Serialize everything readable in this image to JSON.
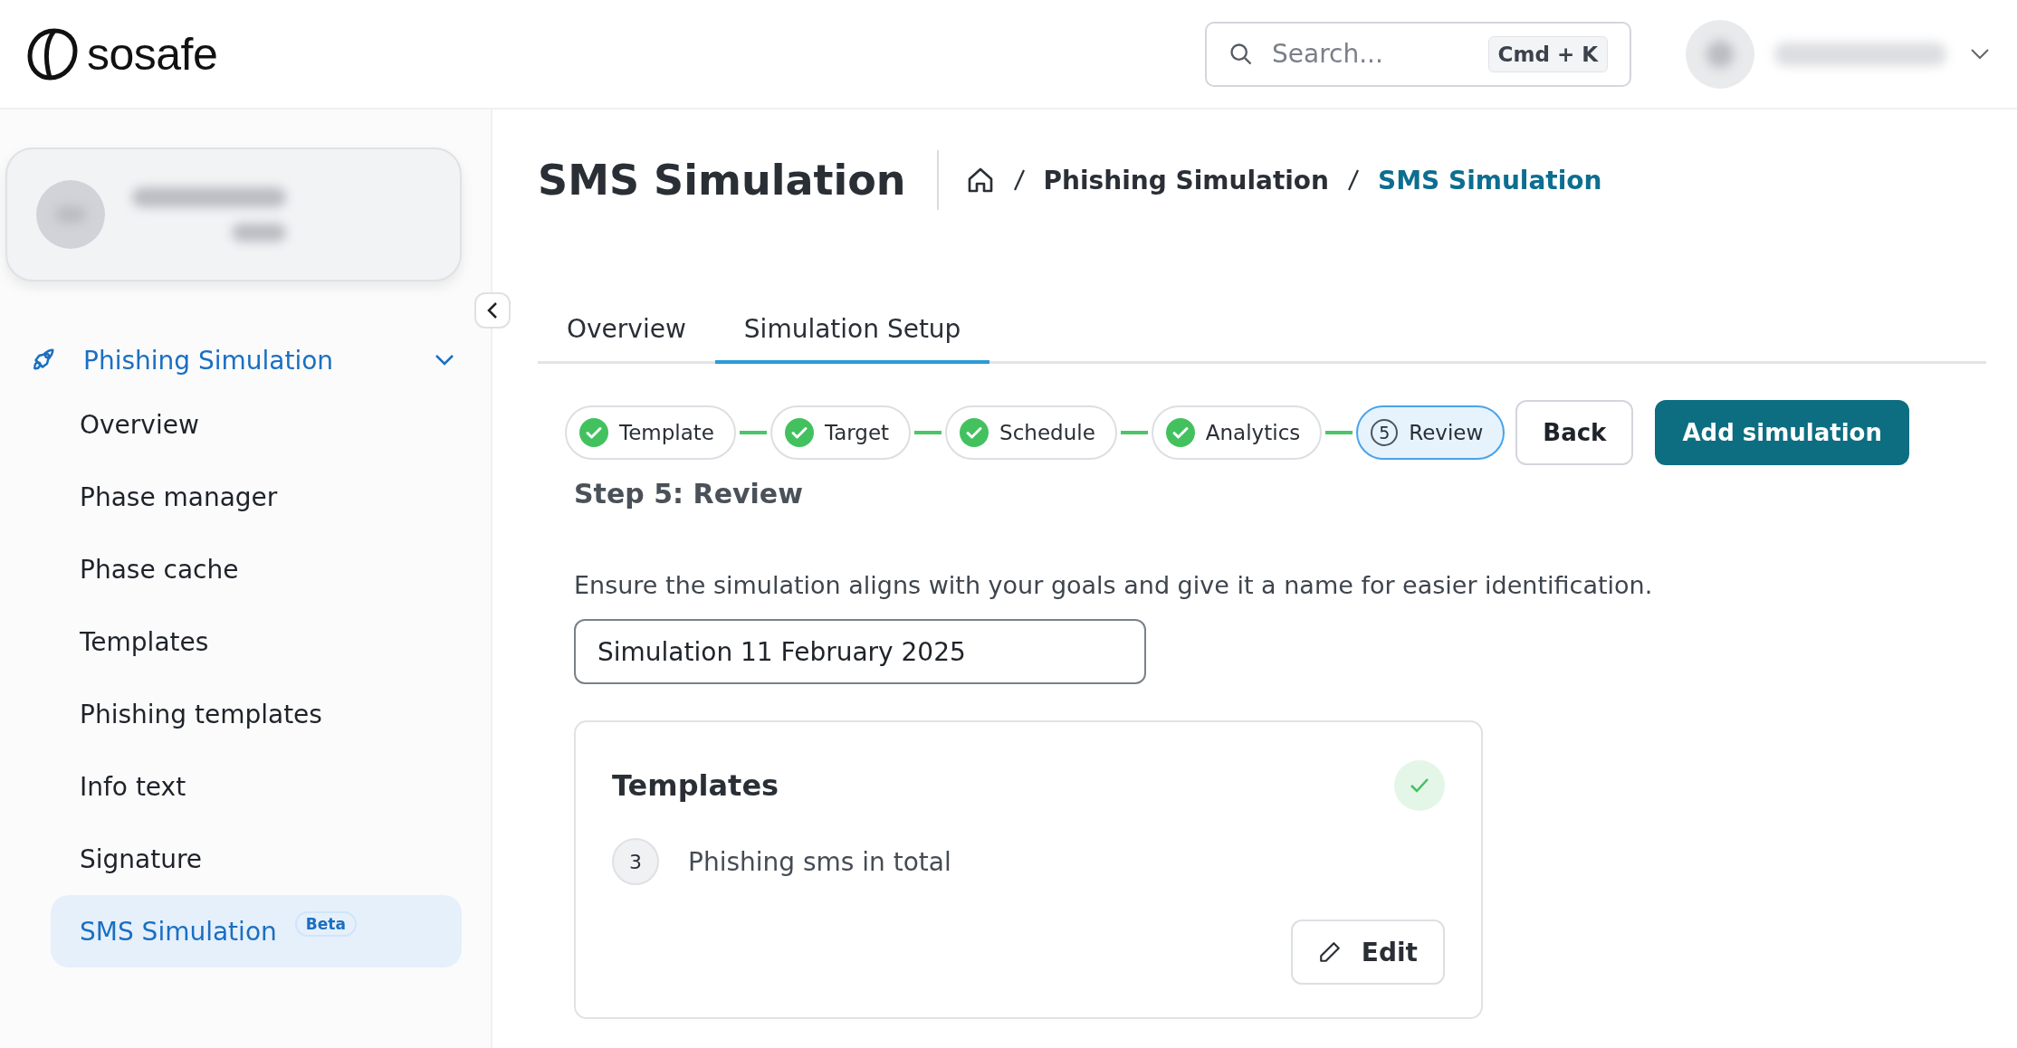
{
  "header": {
    "logo": "sosafe",
    "search": {
      "placeholder": "Search...",
      "shortcut": "Cmd + K"
    }
  },
  "sidebar": {
    "section": {
      "label": "Phishing Simulation",
      "expanded": true
    },
    "items": [
      {
        "label": "Overview",
        "selected": false
      },
      {
        "label": "Phase manager",
        "selected": false
      },
      {
        "label": "Phase cache",
        "selected": false
      },
      {
        "label": "Templates",
        "selected": false
      },
      {
        "label": "Phishing templates",
        "selected": false
      },
      {
        "label": "Info text",
        "selected": false
      },
      {
        "label": "Signature",
        "selected": false
      },
      {
        "label": "SMS Simulation",
        "selected": true,
        "badge": "Beta"
      }
    ]
  },
  "page": {
    "title": "SMS Simulation",
    "breadcrumb": [
      "Phishing Simulation",
      "SMS Simulation"
    ],
    "tabs": [
      {
        "label": "Overview",
        "selected": false
      },
      {
        "label": "Simulation Setup",
        "selected": true
      }
    ],
    "steps": [
      {
        "label": "Template",
        "completed": true,
        "selected": false
      },
      {
        "label": "Target",
        "completed": true,
        "selected": false
      },
      {
        "label": "Schedule",
        "completed": true,
        "selected": false
      },
      {
        "label": "Analytics",
        "completed": true,
        "selected": false
      },
      {
        "label": "Review",
        "completed": false,
        "selected": true,
        "number": "5"
      }
    ],
    "buttons": {
      "back": "Back",
      "primary": "Add simulation"
    },
    "step_title": "Step 5: Review",
    "description": "Ensure the simulation aligns with your goals and give it a name for easier identification.",
    "name_value": "Simulation 11 February 2025",
    "card": {
      "title": "Templates",
      "complete": true,
      "count": "3",
      "count_label": "Phishing sms in total",
      "edit": "Edit"
    }
  }
}
